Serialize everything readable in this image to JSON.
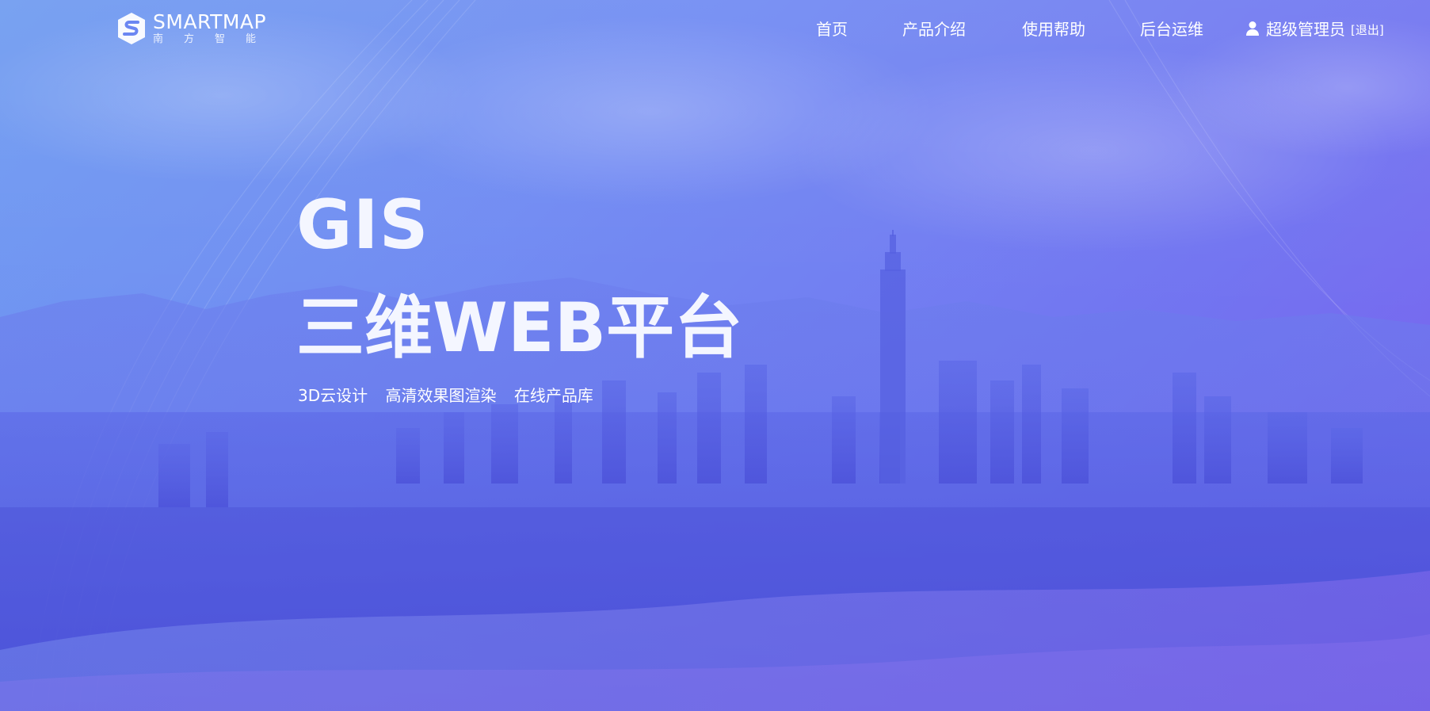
{
  "logo": {
    "name": "SMARTMAP",
    "subtitle": "南方智能"
  },
  "nav": {
    "items": [
      {
        "label": "首页"
      },
      {
        "label": "产品介绍"
      },
      {
        "label": "使用帮助"
      },
      {
        "label": "后台运维"
      }
    ]
  },
  "user": {
    "name": "超级管理员",
    "logout": "[退出]"
  },
  "hero": {
    "title_line1": "GIS",
    "title_line2": "三维WEB平台",
    "features": [
      "3D云设计",
      "高清效果图渲染",
      "在线产品库"
    ]
  },
  "colors": {
    "bg_start": "#6a98f0",
    "bg_end": "#7757ec",
    "text": "#ffffff"
  },
  "icons": {
    "logo": "cube-s-logo-icon",
    "user": "user-icon"
  }
}
